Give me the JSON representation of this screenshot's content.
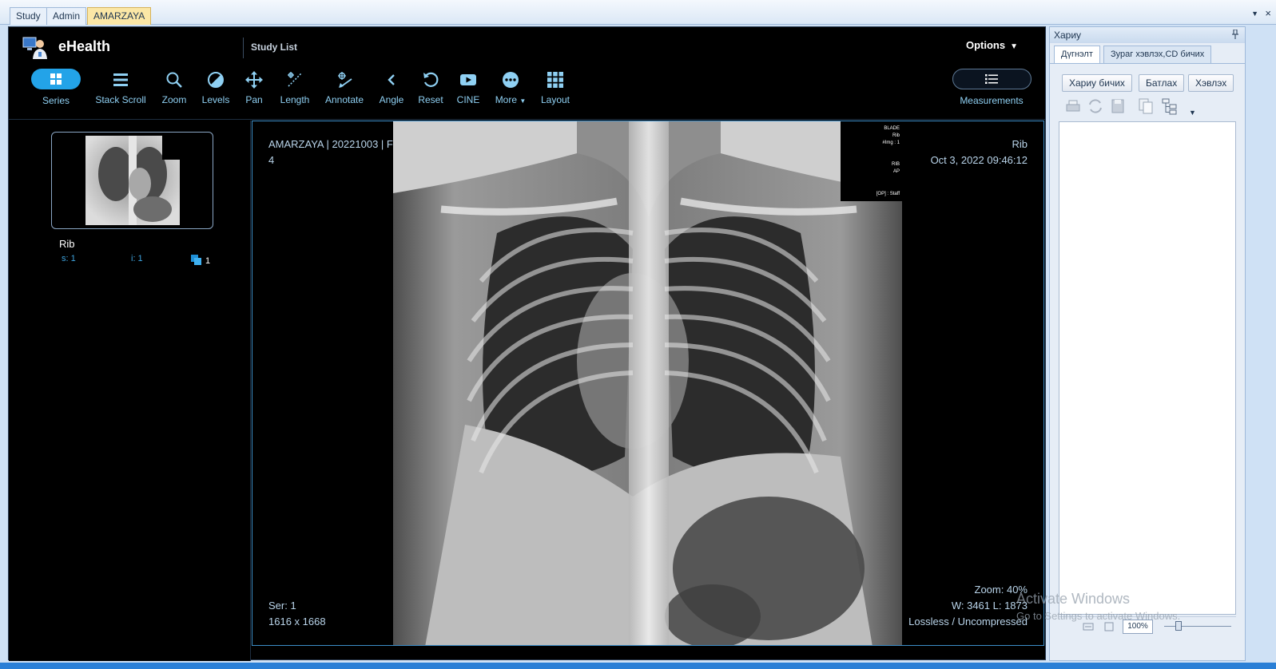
{
  "app_tabs": [
    {
      "label": "Study"
    },
    {
      "label": "Admin"
    },
    {
      "label": "AMARZAYA",
      "active": true
    }
  ],
  "viewer": {
    "brand": "eHealth",
    "study_list_label": "Study List",
    "options_label": "Options",
    "toolbar": {
      "series": "Series",
      "stack_scroll": "Stack Scroll",
      "zoom": "Zoom",
      "levels": "Levels",
      "pan": "Pan",
      "length": "Length",
      "annotate": "Annotate",
      "angle": "Angle",
      "reset": "Reset",
      "cine": "CINE",
      "more": "More",
      "layout": "Layout",
      "measurements": "Measurements"
    },
    "accent_color": "#23a3e8"
  },
  "series_panel": {
    "description": "Rib",
    "series_number_label": "s: 1",
    "instance_label": "i: 1",
    "image_count": "1"
  },
  "viewport": {
    "top_left_line1": "AMARZAYA | 20221003 | F",
    "top_left_line2": "4",
    "top_right_line1": "Rib",
    "top_right_line2": "Oct 3, 2022 09:46:12",
    "bottom_left_line1": "Ser: 1",
    "bottom_left_line2": "1616 x 1668",
    "bottom_right_line1": "Zoom: 40%",
    "bottom_right_line2": "W: 3461 L: 1873",
    "bottom_right_line3": "Lossless / Uncompressed",
    "burn_in": {
      "line1": "BLADE",
      "line2": "Rib",
      "line3": "#Img : 1",
      "line4": "RIB",
      "line5": "AP",
      "line6": "[OP] : Staff"
    }
  },
  "report_panel": {
    "title": "Хариу",
    "tabs": [
      "Дүгнэлт",
      "Зураг хэвлэх,CD бичих"
    ],
    "buttons": {
      "write": "Хариу бичих",
      "approve": "Батлах",
      "print": "Хэвлэх"
    },
    "zoom_value": "100%"
  },
  "watermark": {
    "line1": "Activate Windows",
    "line2": "Go to Settings to activate Windows."
  }
}
